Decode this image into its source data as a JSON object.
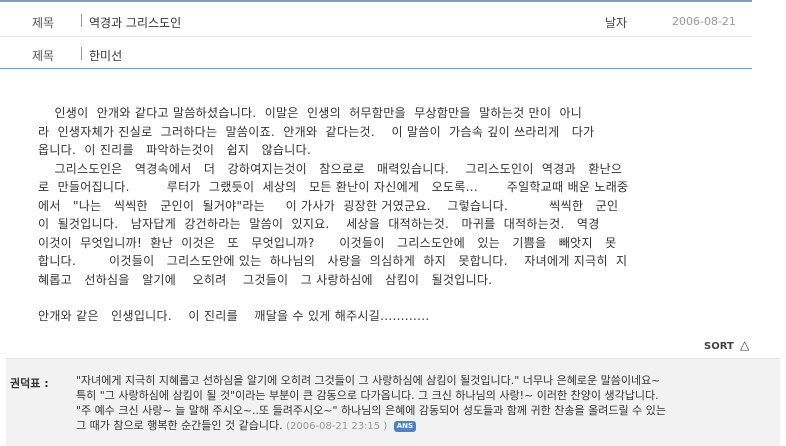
{
  "post": {
    "title_label": "제목",
    "title": "역경과 그리스도인",
    "date_label": "날자",
    "date": "2006-08-21",
    "author_label": "제목",
    "author": "한미선"
  },
  "body": {
    "lines": [
      "    인생이  안개와 같다고 말씀하셨습니다.  이말은  인생의  허무함만을  무상함만을  말하는것 만이  아니",
      "라  인생자체가 진실로  그러하다는  말씀이죠.  안개와  같다는것.    이 말씀이  가슴속 깊이 쓰라리게   다가",
      "옵니다.  이 진리를   파악하는것이   쉽지   않습니다.",
      "    그리스도인은   역경속에서   더   강하여지는것이   참으로로   매력있습니다.    그리스도인이  역경과   환난으",
      "로  만들어집니다.         루터가  그랬듯이  세상의   모든 환난이 자신에게   오도록...       주일학교때 배운 노래중",
      "에서   \"나는   씩씩한   군인이  될거야\"라는     이 가사가  굉장한 거였군요.    그렇습니다.          씩씩한   군인",
      "이  될것입니다.   남자답게  강건하라는  말씀이  있지요.    세상을  대적하는것.   마귀를  대적하는것.   역경",
      "이것이  무엇입니까!  환난  이것은   또   무엇입니까?      이것들이   그리스도안에   있는   기쁨을   빼앗지   못",
      "합니다.        이것들이   그리스도안에 있는  하나님의   사랑을  의심하게  하지   못합니다.    자녀에게 지극히  지",
      "혜롭고   선하심을   알기에    오히려    그것들이   그 사랑하심에   삼킴이   될것입니다.",
      "",
      "안개와 같은   인생입니다.    이 진리를    깨달을 수 있게 해주시길............"
    ]
  },
  "sort": {
    "label": "SORT",
    "arrow": "△"
  },
  "comment": {
    "author": "권덕표 :",
    "lines": [
      "\"자녀에게 지극히 지혜롭고 선하심을 알기에 오히려 그것들이 그 사랑하심에 삼킴이 될것입니다.\" 너무나 은혜로운 말씀이네요~",
      "특히 \"그 사랑하심에 삼킴이 될 것\"이라는 부분이 큰 감동으로 다가옵니다. 그 크신 하나님의 사랑!~ 이러한 찬양이 생각납니다.",
      "\"주 예수 크신 사랑~ 늘 말해 주시오~..또 들려주시오~\" 하나님의 은혜에 감동되어 성도들과 함께 귀한 찬송을 올려드릴 수 있는",
      "그 때가 참으로 행복한 순간들인 것 같습니다."
    ],
    "timestamp": "(2006-08-21 23:15 )",
    "reply_badge": "ANS"
  }
}
